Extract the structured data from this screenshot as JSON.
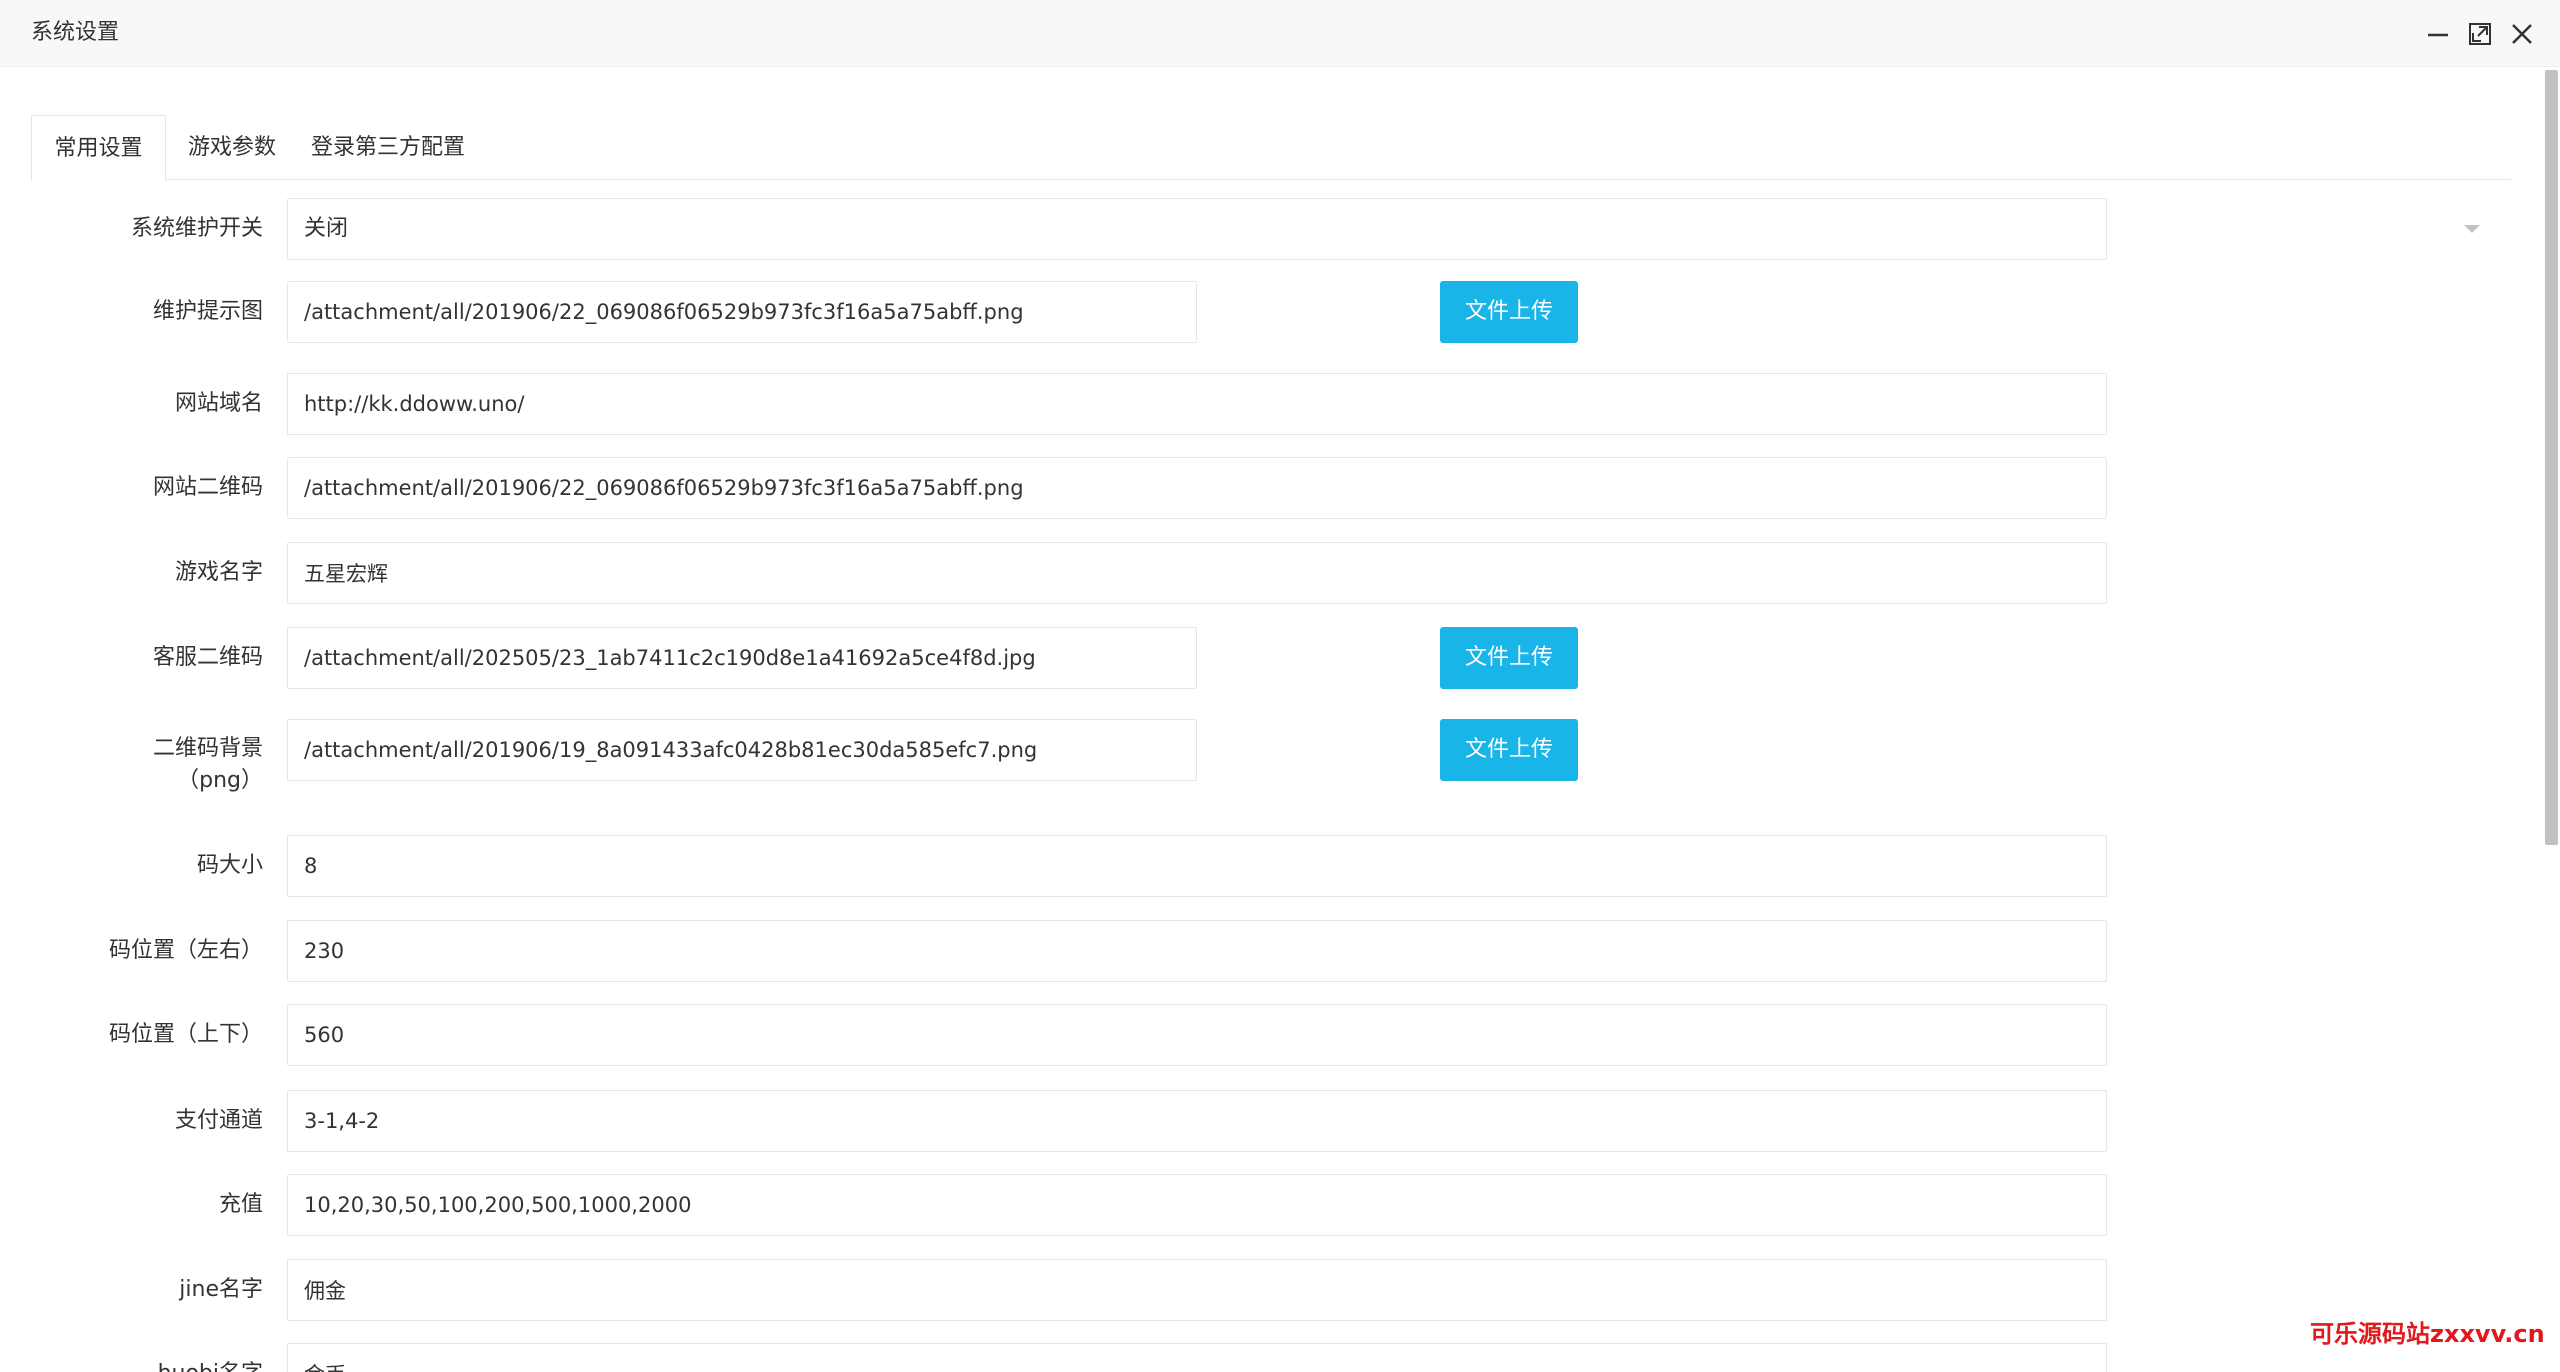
{
  "window": {
    "title": "系统设置"
  },
  "tabs": [
    {
      "label": "常用设置",
      "active": true
    },
    {
      "label": "游戏参数",
      "active": false
    },
    {
      "label": "登录第三方配置",
      "active": false
    }
  ],
  "form": {
    "maintenance": {
      "label": "系统维护开关",
      "value": "关闭"
    },
    "maintenance_image": {
      "label": "维护提示图",
      "value": "/attachment/all/201906/22_069086f06529b973fc3f16a5a75abff.png",
      "button": "文件上传"
    },
    "site_domain": {
      "label": "网站域名",
      "value": "http://kk.ddoww.uno/"
    },
    "site_qrcode": {
      "label": "网站二维码",
      "value": "/attachment/all/201906/22_069086f06529b973fc3f16a5a75abff.png"
    },
    "game_name": {
      "label": "游戏名字",
      "value": "五星宏辉"
    },
    "service_qrcode": {
      "label": "客服二维码",
      "value": "/attachment/all/202505/23_1ab7411c2c190d8e1a41692a5ce4f8d.jpg",
      "button": "文件上传"
    },
    "qrcode_bg": {
      "label_line1": "二维码背景",
      "label_line2": "（png）",
      "value": "/attachment/all/201906/19_8a091433afc0428b81ec30da585efc7.png",
      "button": "文件上传"
    },
    "code_size": {
      "label": "码大小",
      "value": "8"
    },
    "code_pos_lr": {
      "label": "码位置（左右）",
      "value": "230"
    },
    "code_pos_tb": {
      "label": "码位置（上下）",
      "value": "560"
    },
    "pay_channel": {
      "label": "支付通道",
      "value": "3-1,4-2"
    },
    "recharge": {
      "label": "充值",
      "value": "10,20,30,50,100,200,500,1000,2000"
    },
    "jine_name": {
      "label": "jine名字",
      "value": "佣金"
    },
    "partial_row": {
      "label": "huobi名字",
      "value": "金币"
    }
  },
  "watermark": "可乐源码站zxxvv.cn",
  "colors": {
    "upload_button": "#1ab5e8",
    "watermark": "#e0191d"
  }
}
